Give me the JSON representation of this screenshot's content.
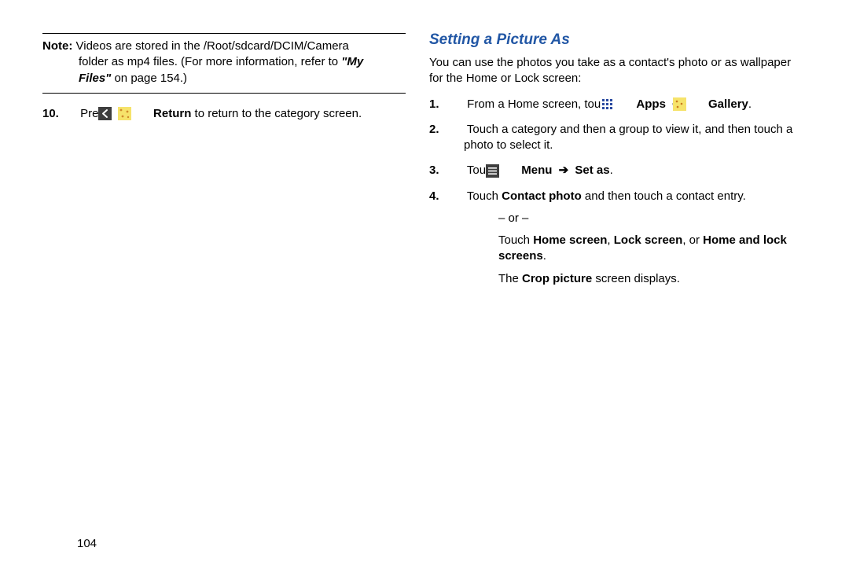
{
  "left": {
    "note_label": "Note:",
    "note_line1": "Videos are stored in the /Root/sdcard/DCIM/Camera",
    "note_line2_a": "folder as mp4 files. (For more information, refer to ",
    "note_line2_b": "\"My",
    "note_line3_a": "Files\"",
    "note_line3_b": " on page 154.)",
    "step10_num": "10.",
    "step10_a": "Press ",
    "step10_return": "Return",
    "step10_b": " to return to the category screen."
  },
  "right": {
    "heading": "Setting a Picture As",
    "intro": "You can use the photos you take as a contact's photo or as wallpaper for the Home or Lock screen:",
    "s1_num": "1.",
    "s1_a": "From a Home screen, touch ",
    "s1_apps": "Apps",
    "s1_gallery": "Gallery",
    "s1_period": ".",
    "s2_num": "2.",
    "s2": "Touch a category and then a group to view it, and then touch a photo to select it.",
    "s3_num": "3.",
    "s3_a": "Touch ",
    "s3_menu": "Menu",
    "s3_setas": "Set as",
    "s3_period": ".",
    "s4_num": "4.",
    "s4_a": "Touch ",
    "s4_contactphoto": "Contact photo",
    "s4_b": " and then touch a contact entry.",
    "s4_or": "– or –",
    "s4_c": "Touch ",
    "s4_home": "Home screen",
    "s4_comma": ", ",
    "s4_lock": "Lock screen",
    "s4_comma_or": ", or ",
    "s4_homelock": "Home and lock screens",
    "s4_period": ".",
    "s4_d": "The ",
    "s4_crop": "Crop picture",
    "s4_e": " screen displays."
  },
  "arrow": "➔",
  "page_number": "104"
}
